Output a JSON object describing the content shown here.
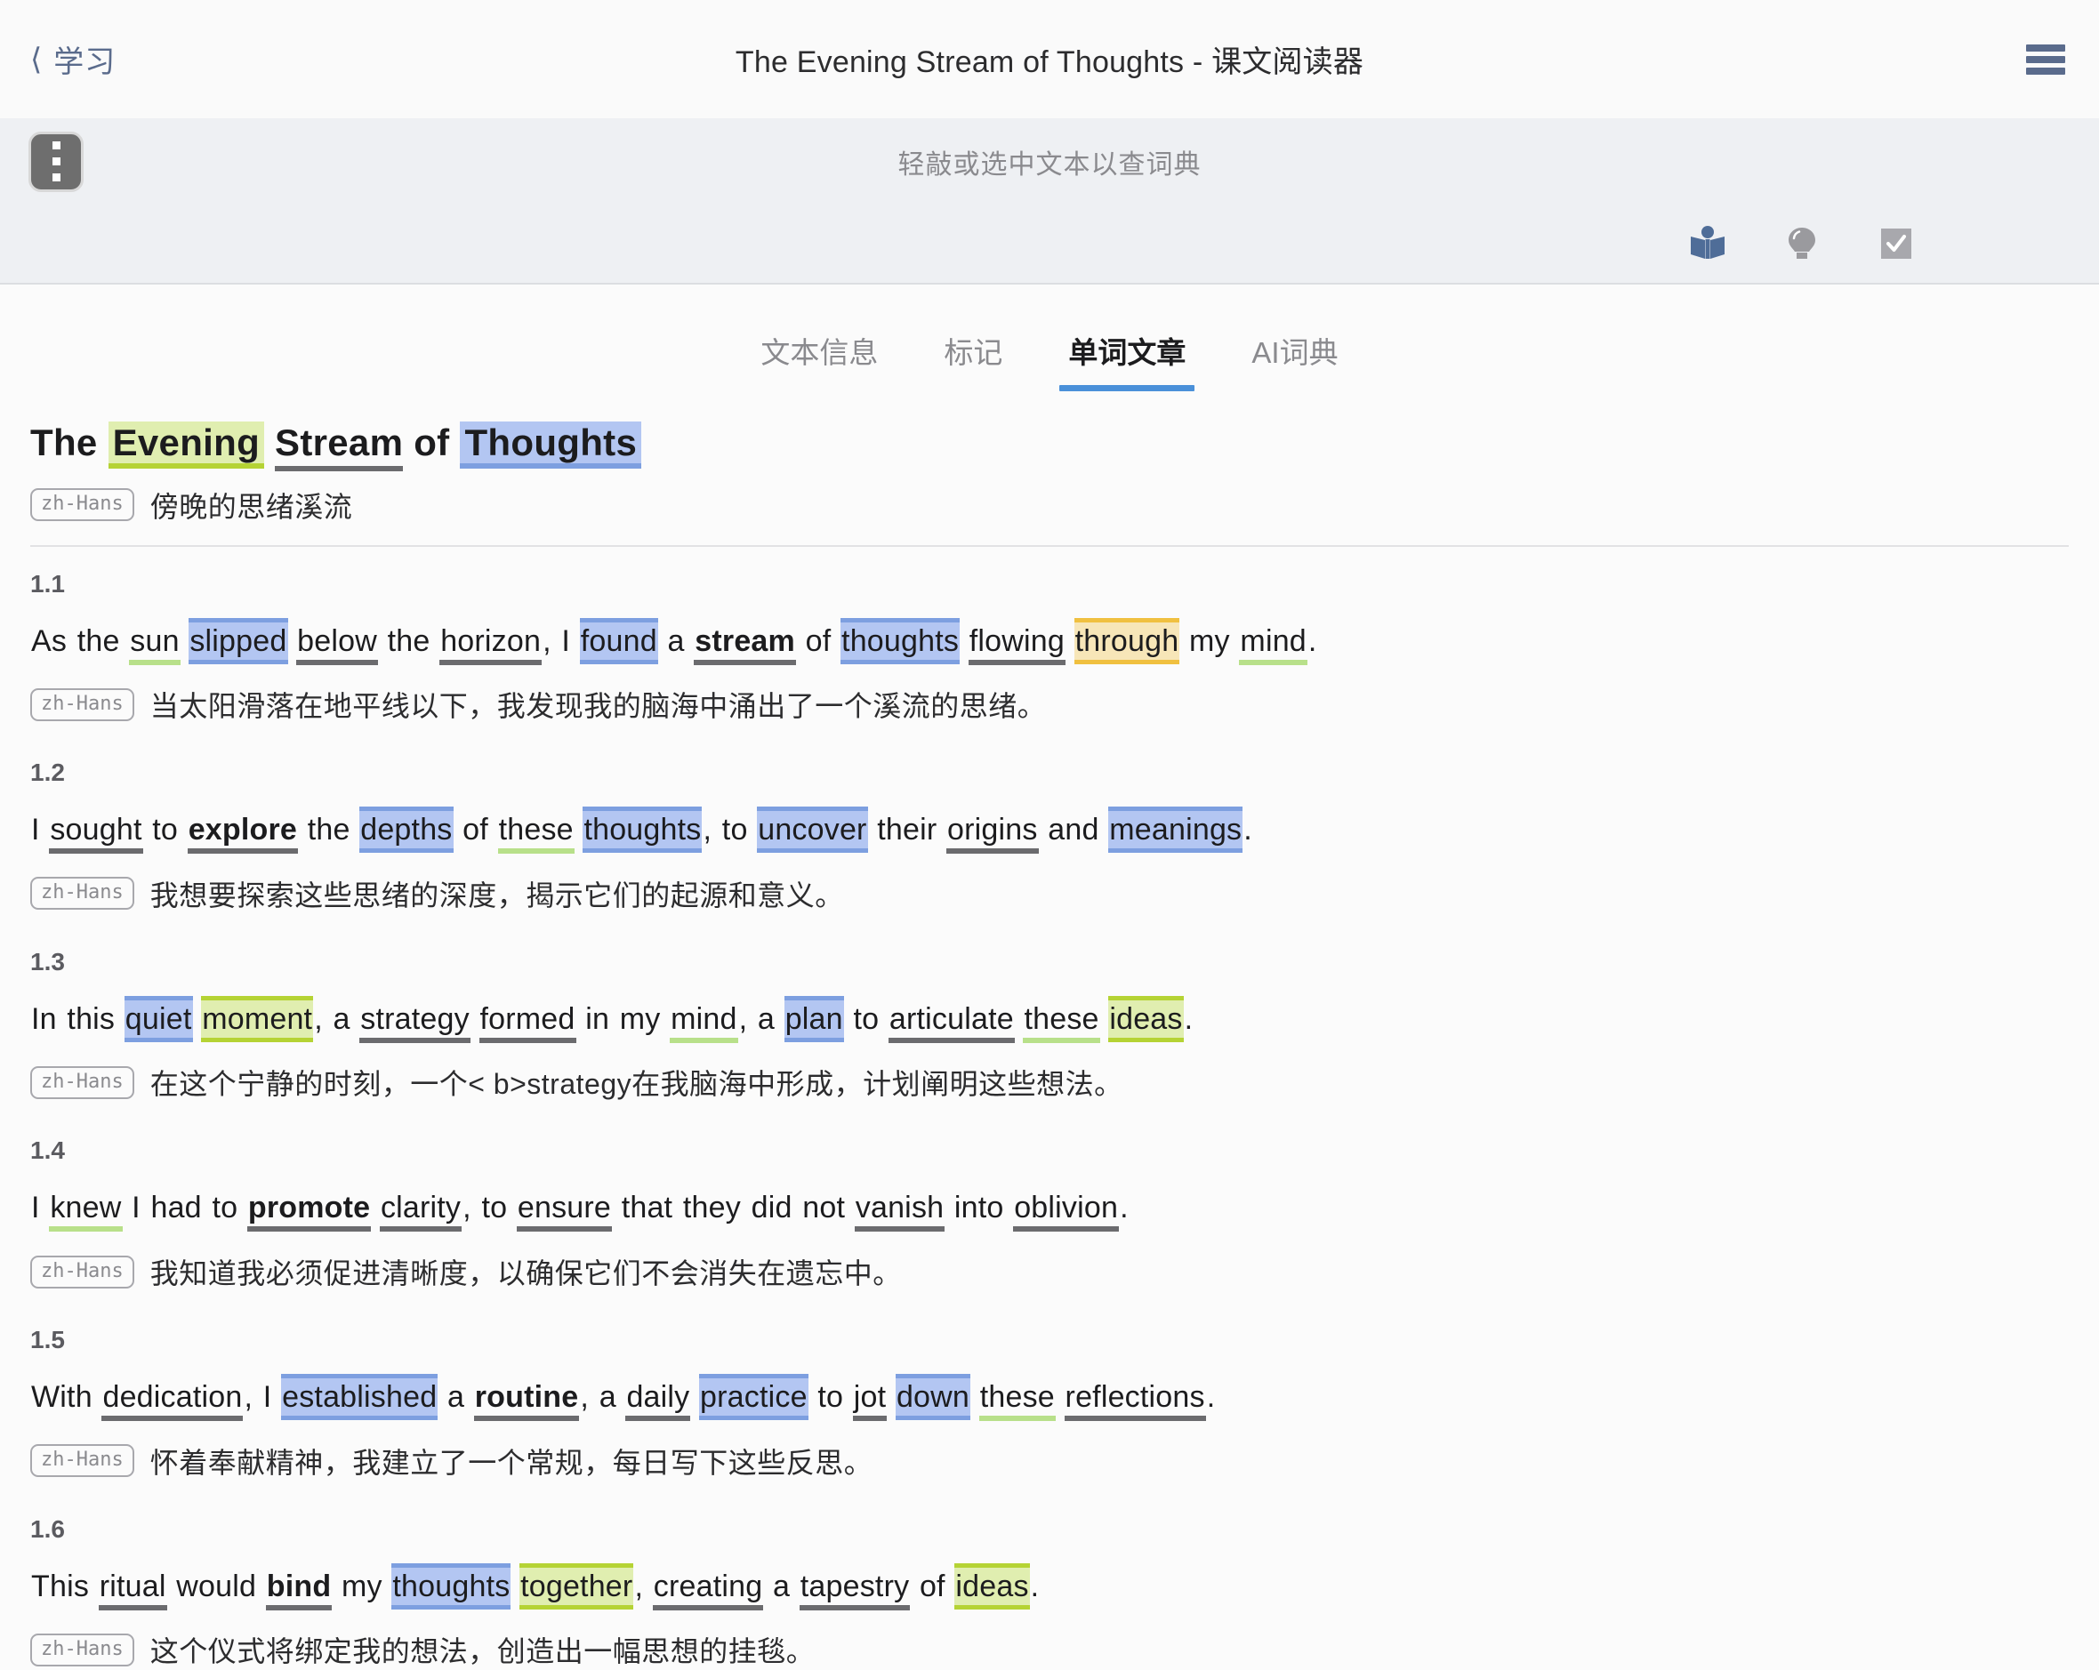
{
  "navbar": {
    "back_label": "学习",
    "back_chevron": "chevron-left-icon",
    "title": "The Evening Stream of Thoughts - 课文阅读器",
    "menu_icon": "hamburger-menu-icon"
  },
  "hintbar": {
    "kebab_icon": "kebab-menu-icon",
    "hint": "轻敲或选中文本以查词典"
  },
  "toolbar": {
    "icons": [
      {
        "name": "open-book-icon",
        "color": "#4f6d98"
      },
      {
        "name": "lightbulb-icon",
        "color": "#9a9a9e"
      },
      {
        "name": "checkbox-checked-icon",
        "color": "#a8a8ad"
      }
    ]
  },
  "tabs": [
    {
      "label": "文本信息",
      "active": false
    },
    {
      "label": "标记",
      "active": false
    },
    {
      "label": "单词文章",
      "active": true
    },
    {
      "label": "AI词典",
      "active": false
    }
  ],
  "accent_color": "#4a90d9",
  "article": {
    "title_tokens": [
      {
        "text": "The",
        "style": "plain"
      },
      {
        "text": "Evening",
        "style": "title-hl-lime"
      },
      {
        "text": "Stream",
        "style": "title-u-gray"
      },
      {
        "text": "of",
        "style": "plain"
      },
      {
        "text": "Thoughts",
        "style": "title-hl-blue"
      }
    ],
    "title_plain": "The Evening Stream of Thoughts",
    "lang_badge": "zh-Hans",
    "title_translation": "傍晚的思绪溪流",
    "sentences": [
      {
        "num": "1.1",
        "tokens": [
          {
            "t": "As",
            "s": ""
          },
          {
            "t": "the",
            "s": ""
          },
          {
            "t": "sun",
            "s": "u-green"
          },
          {
            "t": "slipped",
            "s": "hl-blue"
          },
          {
            "t": "below",
            "s": "u-gray"
          },
          {
            "t": "the",
            "s": ""
          },
          {
            "t": "horizon",
            "s": "u-gray"
          },
          {
            "t": ",",
            "s": "punct"
          },
          {
            "t": "I",
            "s": ""
          },
          {
            "t": "found",
            "s": "hl-blue"
          },
          {
            "t": "a",
            "s": ""
          },
          {
            "t": "stream",
            "s": "u-gray bold"
          },
          {
            "t": "of",
            "s": ""
          },
          {
            "t": "thoughts",
            "s": "hl-blue"
          },
          {
            "t": "flowing",
            "s": "u-gray"
          },
          {
            "t": "through",
            "s": "hl-orange"
          },
          {
            "t": "my",
            "s": ""
          },
          {
            "t": "mind",
            "s": "u-green"
          },
          {
            "t": ".",
            "s": "punct"
          }
        ],
        "translation": "当太阳滑落在地平线以下，我发现我的脑海中涌出了一个溪流的思绪。"
      },
      {
        "num": "1.2",
        "tokens": [
          {
            "t": "I",
            "s": ""
          },
          {
            "t": "sought",
            "s": "u-gray"
          },
          {
            "t": "to",
            "s": ""
          },
          {
            "t": "explore",
            "s": "u-gray bold"
          },
          {
            "t": "the",
            "s": ""
          },
          {
            "t": "depths",
            "s": "hl-blue"
          },
          {
            "t": "of",
            "s": ""
          },
          {
            "t": "these",
            "s": "u-green"
          },
          {
            "t": "thoughts",
            "s": "hl-blue"
          },
          {
            "t": ",",
            "s": "punct"
          },
          {
            "t": "to",
            "s": ""
          },
          {
            "t": "uncover",
            "s": "hl-blue"
          },
          {
            "t": "their",
            "s": ""
          },
          {
            "t": "origins",
            "s": "u-gray"
          },
          {
            "t": "and",
            "s": ""
          },
          {
            "t": "meanings",
            "s": "hl-blue"
          },
          {
            "t": ".",
            "s": "punct"
          }
        ],
        "translation": "我想要探索这些思绪的深度，揭示它们的起源和意义。"
      },
      {
        "num": "1.3",
        "tokens": [
          {
            "t": "In",
            "s": ""
          },
          {
            "t": "this",
            "s": ""
          },
          {
            "t": "quiet",
            "s": "hl-blue"
          },
          {
            "t": "moment",
            "s": "hl-lime"
          },
          {
            "t": ",",
            "s": "punct"
          },
          {
            "t": "a",
            "s": ""
          },
          {
            "t": "strategy",
            "s": "u-gray"
          },
          {
            "t": "formed",
            "s": "u-gray"
          },
          {
            "t": "in",
            "s": ""
          },
          {
            "t": "my",
            "s": ""
          },
          {
            "t": "mind",
            "s": "u-green"
          },
          {
            "t": ",",
            "s": "punct"
          },
          {
            "t": "a",
            "s": ""
          },
          {
            "t": "plan",
            "s": "hl-blue"
          },
          {
            "t": "to",
            "s": ""
          },
          {
            "t": "articulate",
            "s": "u-gray"
          },
          {
            "t": "these",
            "s": "u-green"
          },
          {
            "t": "ideas",
            "s": "hl-lime"
          },
          {
            "t": ".",
            "s": "punct"
          }
        ],
        "translation": "在这个宁静的时刻，一个< b>strategy在我脑海中形成，计划阐明这些想法。"
      },
      {
        "num": "1.4",
        "tokens": [
          {
            "t": "I",
            "s": ""
          },
          {
            "t": "knew",
            "s": "u-green"
          },
          {
            "t": "I",
            "s": ""
          },
          {
            "t": "had",
            "s": ""
          },
          {
            "t": "to",
            "s": ""
          },
          {
            "t": "promote",
            "s": "u-gray bold"
          },
          {
            "t": "clarity",
            "s": "u-gray"
          },
          {
            "t": ",",
            "s": "punct"
          },
          {
            "t": "to",
            "s": ""
          },
          {
            "t": "ensure",
            "s": "u-gray"
          },
          {
            "t": "that",
            "s": ""
          },
          {
            "t": "they",
            "s": ""
          },
          {
            "t": "did",
            "s": ""
          },
          {
            "t": "not",
            "s": ""
          },
          {
            "t": "vanish",
            "s": "u-gray"
          },
          {
            "t": "into",
            "s": ""
          },
          {
            "t": "oblivion",
            "s": "u-gray"
          },
          {
            "t": ".",
            "s": "punct"
          }
        ],
        "translation": "我知道我必须促进清晰度，以确保它们不会消失在遗忘中。"
      },
      {
        "num": "1.5",
        "tokens": [
          {
            "t": "With",
            "s": ""
          },
          {
            "t": "dedication",
            "s": "u-gray"
          },
          {
            "t": ",",
            "s": "punct"
          },
          {
            "t": "I",
            "s": ""
          },
          {
            "t": "established",
            "s": "hl-blue"
          },
          {
            "t": "a",
            "s": ""
          },
          {
            "t": "routine",
            "s": "u-gray bold"
          },
          {
            "t": ",",
            "s": "punct"
          },
          {
            "t": "a",
            "s": ""
          },
          {
            "t": "daily",
            "s": "u-gray"
          },
          {
            "t": "practice",
            "s": "hl-blue"
          },
          {
            "t": "to",
            "s": ""
          },
          {
            "t": "jot",
            "s": "u-gray"
          },
          {
            "t": "down",
            "s": "hl-blue"
          },
          {
            "t": "these",
            "s": "u-green"
          },
          {
            "t": "reflections",
            "s": "u-gray"
          },
          {
            "t": ".",
            "s": "punct"
          }
        ],
        "translation": "怀着奉献精神，我建立了一个常规，每日写下这些反思。"
      },
      {
        "num": "1.6",
        "tokens": [
          {
            "t": "This",
            "s": ""
          },
          {
            "t": "ritual",
            "s": "u-gray"
          },
          {
            "t": "would",
            "s": ""
          },
          {
            "t": "bind",
            "s": "u-gray bold"
          },
          {
            "t": "my",
            "s": ""
          },
          {
            "t": "thoughts",
            "s": "hl-blue"
          },
          {
            "t": "together",
            "s": "hl-lime"
          },
          {
            "t": ",",
            "s": "punct"
          },
          {
            "t": "creating",
            "s": "u-gray"
          },
          {
            "t": "a",
            "s": ""
          },
          {
            "t": "tapestry",
            "s": "u-gray"
          },
          {
            "t": "of",
            "s": ""
          },
          {
            "t": "ideas",
            "s": "hl-lime"
          },
          {
            "t": ".",
            "s": "punct"
          }
        ],
        "translation": "这个仪式将绑定我的想法，创造出一幅思想的挂毯。"
      }
    ]
  }
}
